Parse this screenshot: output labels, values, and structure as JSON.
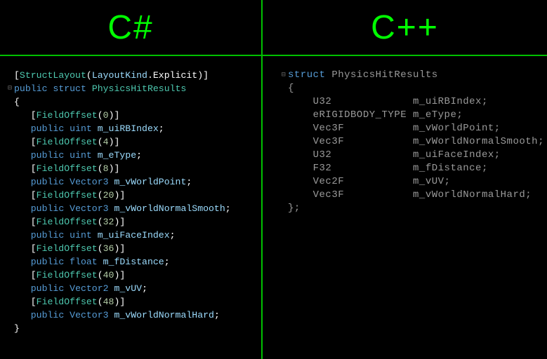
{
  "headers": {
    "left": "C#",
    "right": "C++"
  },
  "csharp": {
    "attr_struct": "StructLayout",
    "attr_struct_arg": "LayoutKind",
    "attr_struct_member": "Explicit",
    "kw_public": "public",
    "kw_struct": "struct",
    "struct_name": "PhysicsHitResults",
    "brace_open": "{",
    "brace_close": "}",
    "fields": [
      {
        "offset": "0",
        "type": "uint",
        "name": "m_uiRBIndex"
      },
      {
        "offset": "4",
        "type": "uint",
        "name": "m_eType"
      },
      {
        "offset": "8",
        "type": "Vector3",
        "name": "m_vWorldPoint"
      },
      {
        "offset": "20",
        "type": "Vector3",
        "name": "m_vWorldNormalSmooth"
      },
      {
        "offset": "32",
        "type": "uint",
        "name": "m_uiFaceIndex"
      },
      {
        "offset": "36",
        "type": "float",
        "name": "m_fDistance"
      },
      {
        "offset": "40",
        "type": "Vector2",
        "name": "m_vUV"
      },
      {
        "offset": "48",
        "type": "Vector3",
        "name": "m_vWorldNormalHard"
      }
    ],
    "field_offset_label": "FieldOffset"
  },
  "cpp": {
    "kw_struct": "struct",
    "struct_name": "PhysicsHitResults",
    "brace_open": "{",
    "brace_close": "};",
    "fields": [
      {
        "type": "U32",
        "name": "m_uiRBIndex"
      },
      {
        "type": "eRIGIDBODY_TYPE",
        "name": "m_eType"
      },
      {
        "type": "Vec3F",
        "name": "m_vWorldPoint"
      },
      {
        "type": "Vec3F",
        "name": "m_vWorldNormalSmooth"
      },
      {
        "type": "U32",
        "name": "m_uiFaceIndex"
      },
      {
        "type": "F32",
        "name": "m_fDistance"
      },
      {
        "type": "Vec2F",
        "name": "m_vUV"
      },
      {
        "type": "Vec3F",
        "name": "m_vWorldNormalHard"
      }
    ]
  }
}
